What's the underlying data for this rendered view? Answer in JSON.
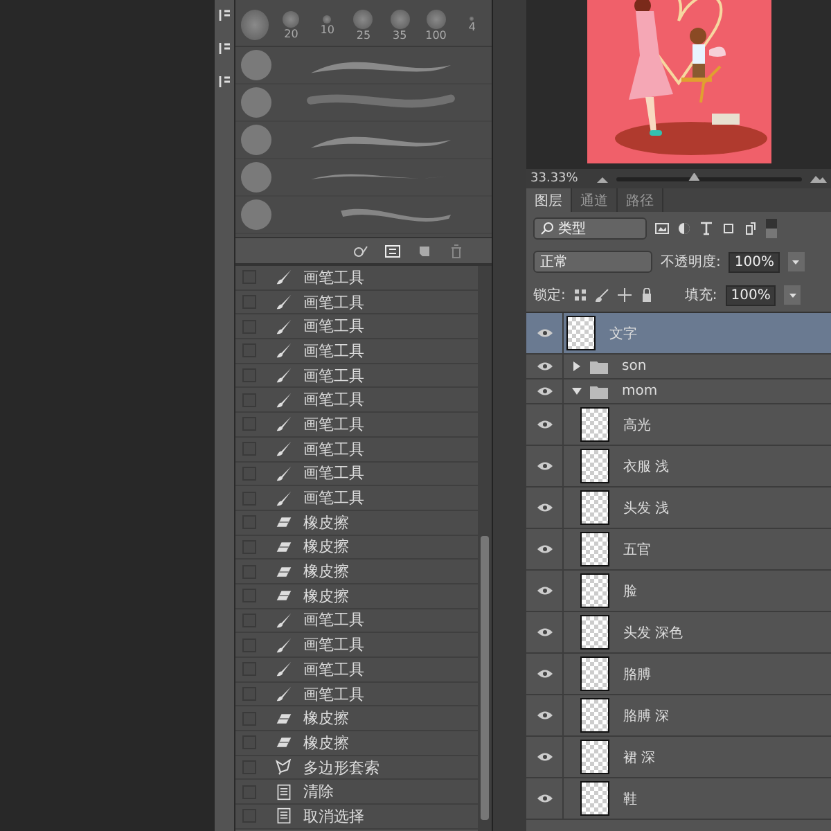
{
  "brush_presets": {
    "sizes": [
      "20",
      "10",
      "25",
      "35",
      "100",
      "4"
    ],
    "strokes": [
      {
        "kind": "smooth"
      },
      {
        "kind": "soft"
      },
      {
        "kind": "smooth"
      },
      {
        "kind": "thin"
      },
      {
        "kind": "bristle"
      }
    ]
  },
  "history": [
    {
      "kind": "brush",
      "label": "画笔工具"
    },
    {
      "kind": "brush",
      "label": "画笔工具"
    },
    {
      "kind": "brush",
      "label": "画笔工具"
    },
    {
      "kind": "brush",
      "label": "画笔工具"
    },
    {
      "kind": "brush",
      "label": "画笔工具"
    },
    {
      "kind": "brush",
      "label": "画笔工具"
    },
    {
      "kind": "brush",
      "label": "画笔工具"
    },
    {
      "kind": "brush",
      "label": "画笔工具"
    },
    {
      "kind": "brush",
      "label": "画笔工具"
    },
    {
      "kind": "brush",
      "label": "画笔工具"
    },
    {
      "kind": "eraser",
      "label": "橡皮擦"
    },
    {
      "kind": "eraser",
      "label": "橡皮擦"
    },
    {
      "kind": "eraser",
      "label": "橡皮擦"
    },
    {
      "kind": "eraser",
      "label": "橡皮擦"
    },
    {
      "kind": "brush",
      "label": "画笔工具"
    },
    {
      "kind": "brush",
      "label": "画笔工具"
    },
    {
      "kind": "brush",
      "label": "画笔工具"
    },
    {
      "kind": "brush",
      "label": "画笔工具"
    },
    {
      "kind": "eraser",
      "label": "橡皮擦"
    },
    {
      "kind": "eraser",
      "label": "橡皮擦"
    },
    {
      "kind": "lasso",
      "label": "多边形套索"
    },
    {
      "kind": "document",
      "label": "清除"
    },
    {
      "kind": "document",
      "label": "取消选择"
    }
  ],
  "canvas": {
    "zoom": "33.33%",
    "zoom_slider": {
      "level": 0.42
    }
  },
  "layers_panel": {
    "tabs": [
      {
        "label": "图层",
        "selected": true
      },
      {
        "label": "通道",
        "selected": false
      },
      {
        "label": "路径",
        "selected": false
      }
    ],
    "filter": "类型",
    "blend_mode": "正常",
    "opacity_label": "不透明度:",
    "opacity": "100%",
    "lock_label": "锁定:",
    "fill_label": "填充:",
    "fill": "100%",
    "layers": [
      {
        "kind": "layer",
        "name": "文字",
        "visible": true,
        "selected": true
      },
      {
        "kind": "group",
        "name": "son",
        "visible": true,
        "selected": false,
        "expanded": false
      },
      {
        "kind": "group",
        "name": "mom",
        "visible": true,
        "selected": false,
        "expanded": true,
        "children": [
          {
            "kind": "layer",
            "name": "高光",
            "visible": true,
            "selected": false
          },
          {
            "kind": "layer",
            "name": "衣服 浅",
            "visible": true,
            "selected": false
          },
          {
            "kind": "layer",
            "name": "头发 浅",
            "visible": true,
            "selected": false
          },
          {
            "kind": "layer",
            "name": "五官",
            "visible": true,
            "selected": false
          },
          {
            "kind": "layer",
            "name": "脸",
            "visible": true,
            "selected": false
          },
          {
            "kind": "layer",
            "name": "头发 深色",
            "visible": true,
            "selected": false
          },
          {
            "kind": "layer",
            "name": "胳膊",
            "visible": true,
            "selected": false
          },
          {
            "kind": "layer",
            "name": "胳膊 深",
            "visible": true,
            "selected": false
          },
          {
            "kind": "layer",
            "name": "裙 深",
            "visible": true,
            "selected": false
          },
          {
            "kind": "layer",
            "name": "鞋",
            "visible": true,
            "selected": false
          }
        ]
      }
    ]
  }
}
